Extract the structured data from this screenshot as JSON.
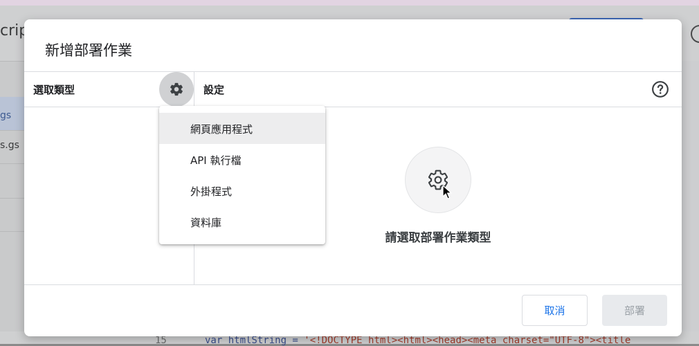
{
  "background": {
    "title_fragment": "crip",
    "sidebar_items": [
      "gs",
      "s.gs"
    ],
    "code_line_number": "15",
    "code_text_prefix": "var htmlString = ",
    "code_text_string": "'<!DOCTYPE html><html><head><meta charset=\"UTF-8\"><title"
  },
  "dialog": {
    "title": "新增部署作業",
    "left_header": "選取類型",
    "right_header": "設定",
    "empty_state_text": "請選取部署作業類型",
    "menu_items": [
      "網頁應用程式",
      "API 執行檔",
      "外掛程式",
      "資料庫"
    ],
    "cancel_label": "取消",
    "deploy_label": "部署"
  },
  "colors": {
    "accent": "#1a73e8",
    "disabled_bg": "#e8eaed",
    "disabled_text": "#9aa0a6"
  },
  "icons": {
    "type_selector": "gear-icon",
    "help": "help-circle-icon",
    "empty_state": "gear-icon",
    "pointer": "mouse-cursor-icon"
  }
}
